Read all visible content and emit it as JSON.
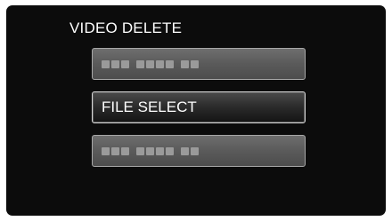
{
  "screen": {
    "title": "VIDEO DELETE"
  },
  "menu": {
    "items": [
      {
        "label": "",
        "state": "hidden-placeholder"
      },
      {
        "label": "FILE SELECT",
        "state": "selected"
      },
      {
        "label": "",
        "state": "hidden-placeholder"
      }
    ]
  },
  "colors": {
    "background": "#0c0c0c",
    "item_dim": "#5a5a5a",
    "item_selected": "#2a2a2a",
    "text": "#ffffff"
  }
}
